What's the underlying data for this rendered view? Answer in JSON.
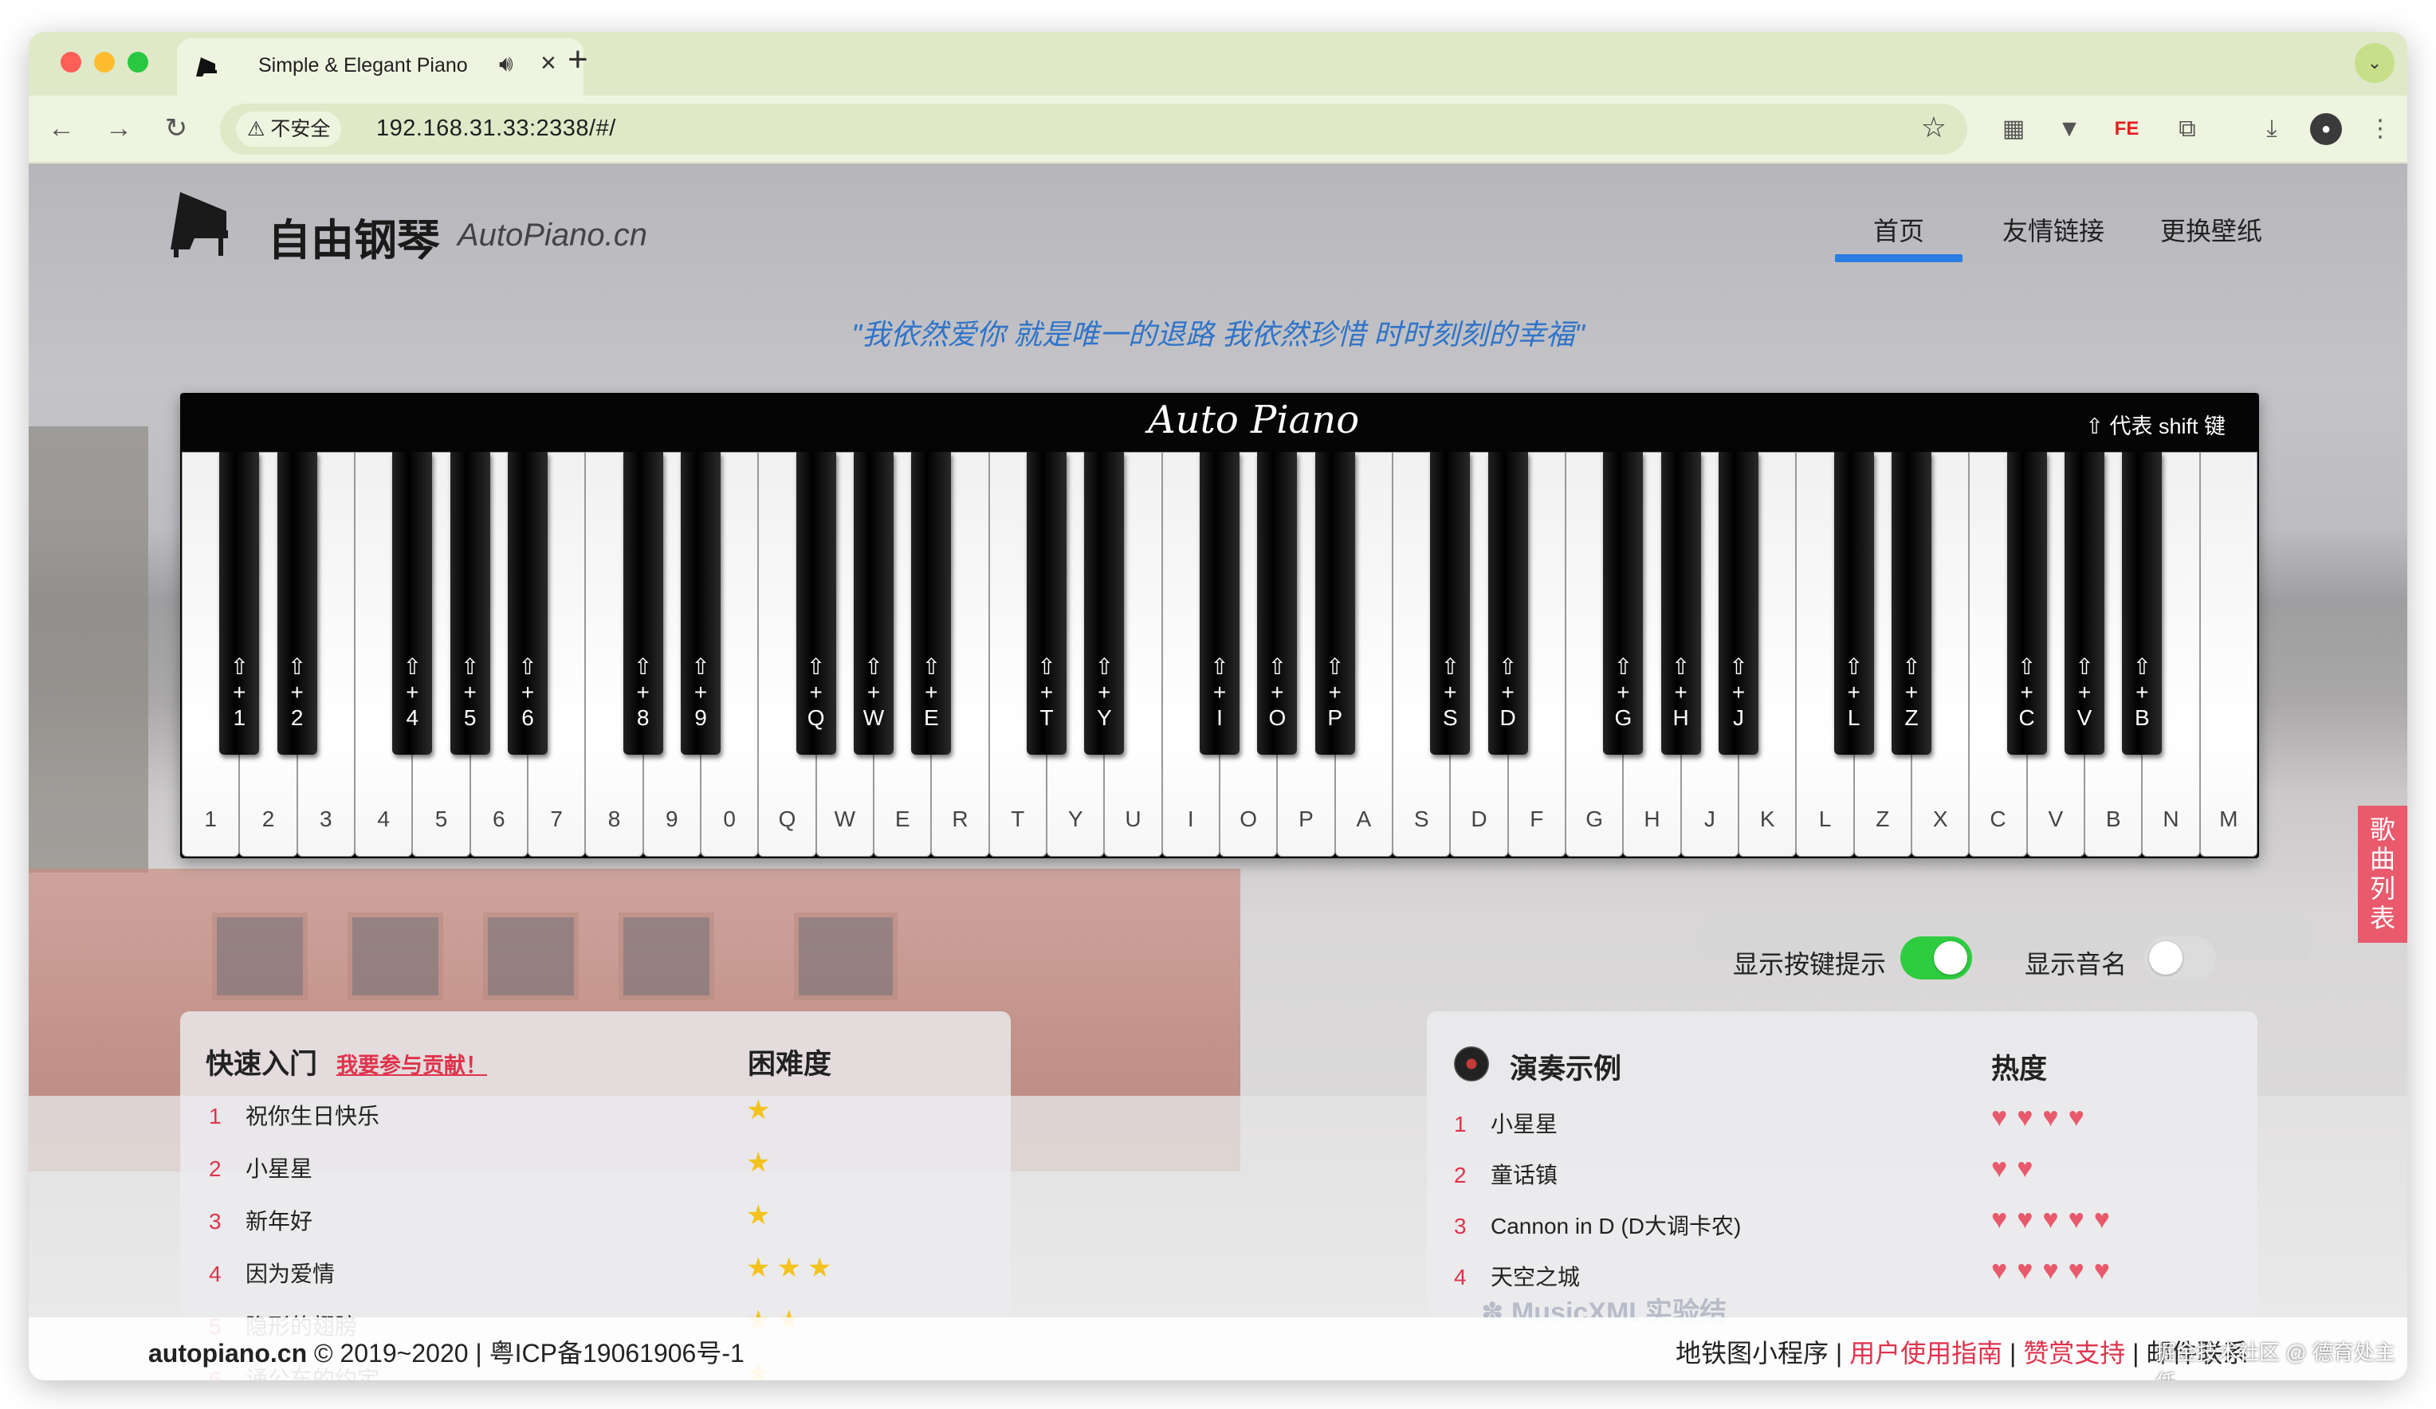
{
  "browser": {
    "tab_title": "Simple & Elegant Piano",
    "security_label": "不安全",
    "url": "192.168.31.33:2338/#/"
  },
  "header": {
    "brand": "自由钢琴",
    "brand_en": "AutoPiano.cn",
    "nav": [
      "首页",
      "友情链接",
      "更换壁纸"
    ],
    "active_nav": "首页"
  },
  "quote": "\"我依然爱你 就是唯一的退路 我依然珍惜 时时刻刻的幸福\"",
  "piano": {
    "title": "Auto Piano",
    "shift_hint": "⇧ 代表 shift 键",
    "white_keys": [
      "1",
      "2",
      "3",
      "4",
      "5",
      "6",
      "7",
      "8",
      "9",
      "0",
      "Q",
      "W",
      "E",
      "R",
      "T",
      "Y",
      "U",
      "I",
      "O",
      "P",
      "A",
      "S",
      "D",
      "F",
      "G",
      "H",
      "J",
      "K",
      "L",
      "Z",
      "X",
      "C",
      "V",
      "B",
      "N",
      "M"
    ],
    "black_keys": [
      "1",
      "2",
      "4",
      "5",
      "6",
      "8",
      "9",
      "Q",
      "W",
      "E",
      "T",
      "Y",
      "I",
      "O",
      "P",
      "S",
      "D",
      "G",
      "H",
      "J",
      "L",
      "Z",
      "C",
      "V",
      "B"
    ]
  },
  "song_list_tab": "歌曲列表",
  "toggles": {
    "show_key_hint": {
      "label": "显示按键提示",
      "on": true
    },
    "show_note_name": {
      "label": "显示音名",
      "on": false
    }
  },
  "quick_start": {
    "title": "快速入门",
    "contribute": "我要参与贡献！",
    "difficulty_header": "困难度",
    "songs": [
      {
        "idx": "1",
        "name": "祝你生日快乐",
        "stars": 1
      },
      {
        "idx": "2",
        "name": "小星星",
        "stars": 1
      },
      {
        "idx": "3",
        "name": "新年好",
        "stars": 1
      },
      {
        "idx": "4",
        "name": "因为爱情",
        "stars": 3
      },
      {
        "idx": "5",
        "name": "隐形的翅膀",
        "stars": 2
      },
      {
        "idx": "6",
        "name": "诵公车的约定",
        "stars": 1
      }
    ]
  },
  "examples": {
    "title": "演奏示例",
    "heat_header": "热度",
    "songs": [
      {
        "idx": "1",
        "name": "小星星",
        "hearts": 4
      },
      {
        "idx": "2",
        "name": "童话镇",
        "hearts": 2
      },
      {
        "idx": "3",
        "name": "Cannon in D (D大调卡农)",
        "hearts": 5
      },
      {
        "idx": "4",
        "name": "天空之城",
        "hearts": 5
      }
    ],
    "musicxml": "MusicXML实验结"
  },
  "footer": {
    "site": "autopiano.cn",
    "copyright": "© 2019~2020",
    "icp": "粤ICP备19061906号-1",
    "links": [
      "地铁图小程序",
      "用户使用指南",
      "赞赏支持",
      "邮件联系"
    ]
  },
  "watermark": "掘金技术社区 @ 德育处主任",
  "colors": {
    "accent": "#2a7de1",
    "red": "#e0334c",
    "toggle_on": "#2ecc40"
  }
}
